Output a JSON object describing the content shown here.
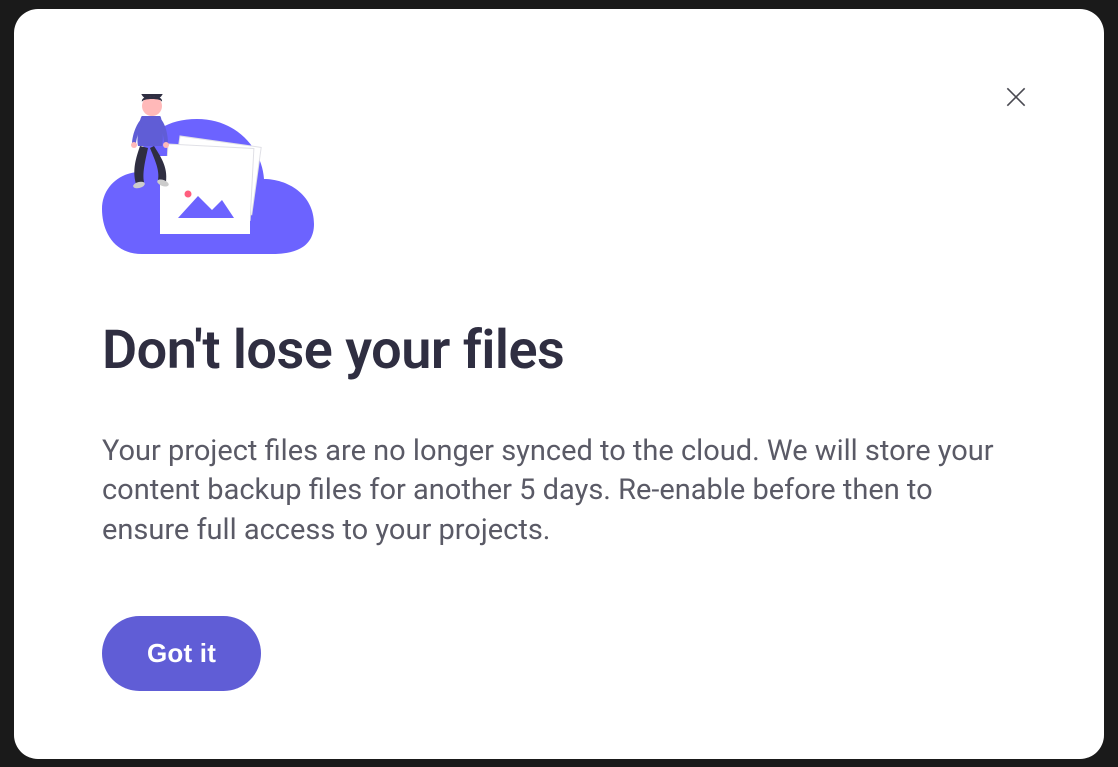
{
  "modal": {
    "heading": "Don't lose your files",
    "body": "Your project files are no longer synced to the cloud. We will store your content backup files for another 5 days. Re-enable before then to ensure full access to your projects.",
    "primary_button_label": "Got it",
    "close_button_label": "Close"
  },
  "colors": {
    "accent": "#605dd6",
    "heading": "#2f2e41",
    "body": "#5a5a66"
  }
}
